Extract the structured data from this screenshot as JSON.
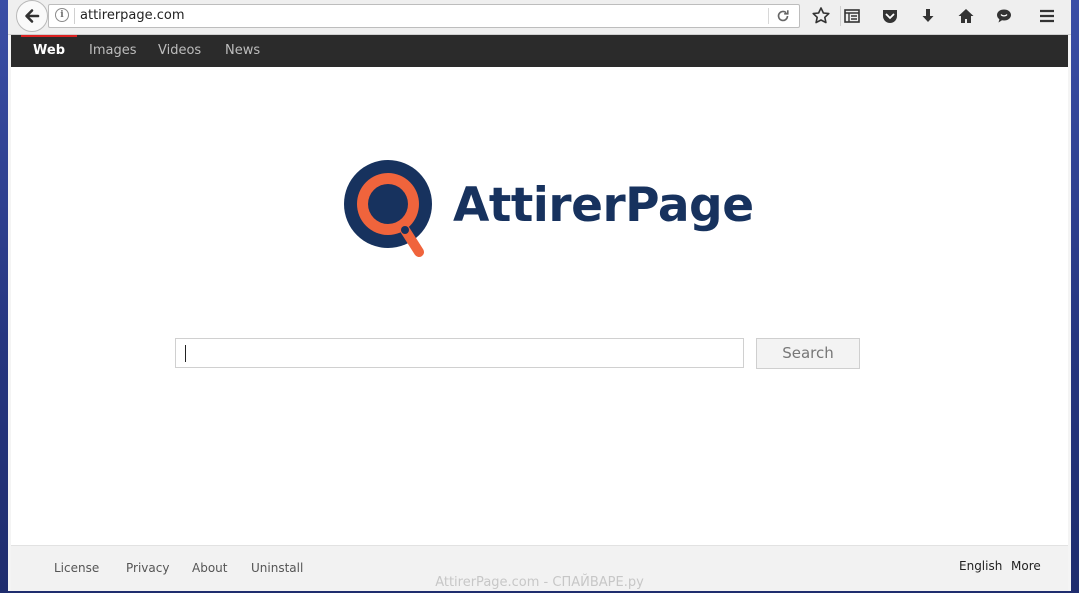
{
  "browser": {
    "url": "attirerpage.com",
    "toolbar_icons": [
      "back-arrow-icon",
      "info-icon",
      "reload-icon",
      "star-icon",
      "reading-list-icon",
      "pocket-icon",
      "download-icon",
      "home-icon",
      "chat-icon",
      "menu-icon"
    ]
  },
  "nav": {
    "items": [
      {
        "label": "Web",
        "active": true
      },
      {
        "label": "Images",
        "active": false
      },
      {
        "label": "Videos",
        "active": false
      },
      {
        "label": "News",
        "active": false
      }
    ]
  },
  "brand": {
    "name": "AttirerPage",
    "colors": {
      "navy": "#17325e",
      "orange": "#f0643c"
    }
  },
  "search": {
    "input_value": "",
    "button_label": "Search"
  },
  "footer": {
    "left_links": [
      "License",
      "Privacy",
      "About",
      "Uninstall"
    ],
    "language": "English",
    "more": "More"
  },
  "watermark": "AttirerPage.com - СПАЙВАРЕ.ру"
}
